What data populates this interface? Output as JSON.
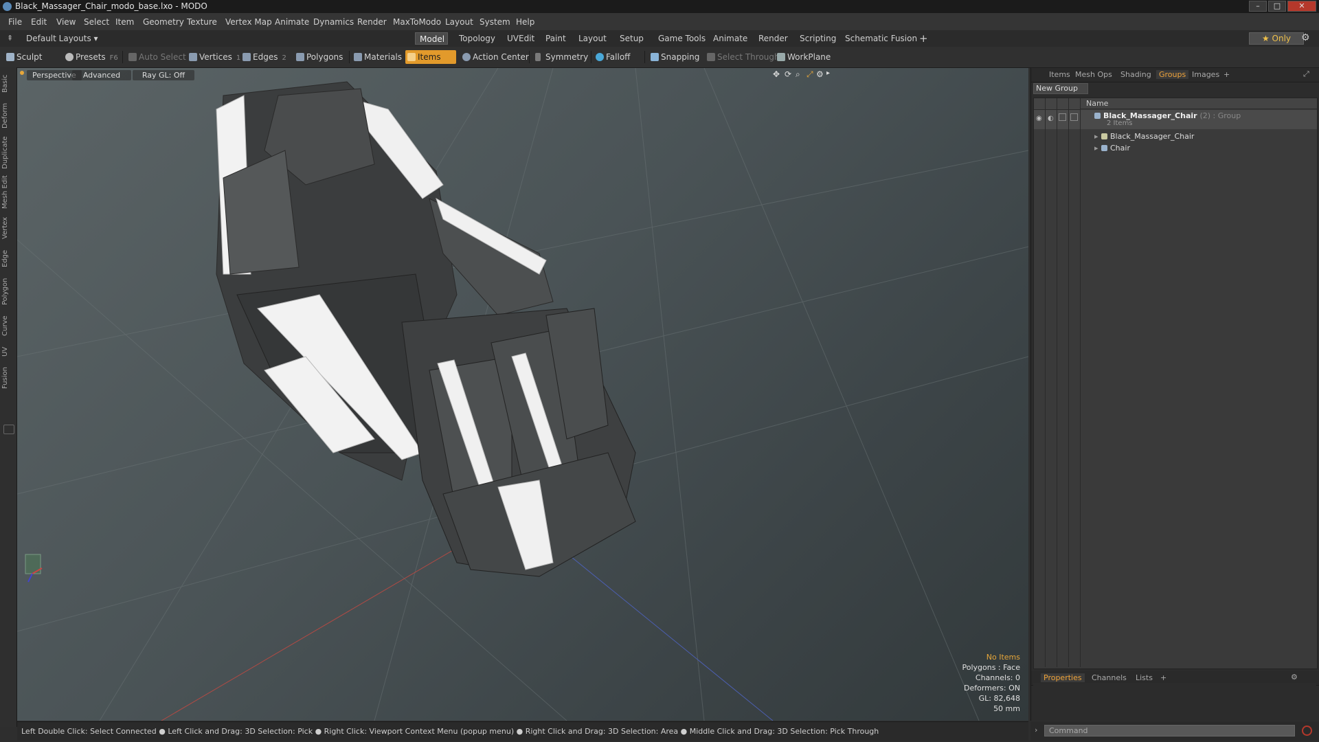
{
  "window": {
    "title": "Black_Massager_Chair_modo_base.lxo - MODO",
    "minimize": "–",
    "maximize": "□",
    "close": "✕"
  },
  "menu": [
    "File",
    "Edit",
    "View",
    "Select",
    "Item",
    "Geometry",
    "Texture",
    "Vertex Map",
    "Animate",
    "Dynamics",
    "Render",
    "MaxToModo",
    "Layout",
    "System",
    "Help"
  ],
  "layouts": {
    "selector": "Default Layouts ▾",
    "tabs": [
      "Model",
      "Topology",
      "UVEdit",
      "Paint",
      "Layout",
      "Setup",
      "Game Tools",
      "Animate",
      "Render",
      "Scripting",
      "Schematic Fusion"
    ],
    "active_tab": "Model",
    "add": "+",
    "only": "★ Only"
  },
  "toolbar": {
    "sculpt": "Sculpt",
    "presets": "Presets",
    "presets_key": "F6",
    "auto_select": "Auto Select",
    "vertices": "Vertices",
    "vertices_count": "1",
    "edges": "Edges",
    "edges_count": "2",
    "polygons": "Polygons",
    "materials": "Materials",
    "items": "Items",
    "items_count": "5",
    "action_center": "Action Center",
    "symmetry": "Symmetry",
    "falloff": "Falloff",
    "snapping": "Snapping",
    "select_through": "Select Through",
    "workplane": "WorkPlane"
  },
  "left_tabs": [
    "Basic",
    "Deform",
    "Duplicate",
    "Mesh Edit",
    "Vertex",
    "Edge",
    "Polygon",
    "Curve",
    "UV",
    "Fusion"
  ],
  "viewport": {
    "view": "Perspective",
    "shading": "Advanced",
    "raygl": "Ray GL: Off",
    "info": {
      "selection": "No Items",
      "polygons": "Polygons : Face",
      "channels": "Channels: 0",
      "deformers": "Deformers: ON",
      "gl": "GL: 82,648",
      "focal": "50 mm"
    }
  },
  "right_panel": {
    "tabs": [
      "Items",
      "Mesh Ops",
      "Shading",
      "Groups",
      "Images"
    ],
    "active_tab": "Groups",
    "add": "+",
    "new_group": "New Group",
    "name_header": "Name",
    "rows": [
      {
        "name": "Black_Massager_Chair",
        "suffix": "(2) : Group",
        "sub": "2 Items"
      },
      {
        "name": "Black_Massager_Chair"
      },
      {
        "name": "Chair"
      }
    ],
    "bottom_tabs": [
      "Properties",
      "Channels",
      "Lists"
    ],
    "bottom_active": "Properties"
  },
  "statusbar": "Left Double Click: Select Connected ● Left Click and Drag: 3D Selection: Pick ● Right Click: Viewport Context Menu (popup menu) ● Right Click and Drag: 3D Selection: Area ● Middle Click and Drag: 3D Selection: Pick Through",
  "command": {
    "placeholder": "Command"
  }
}
